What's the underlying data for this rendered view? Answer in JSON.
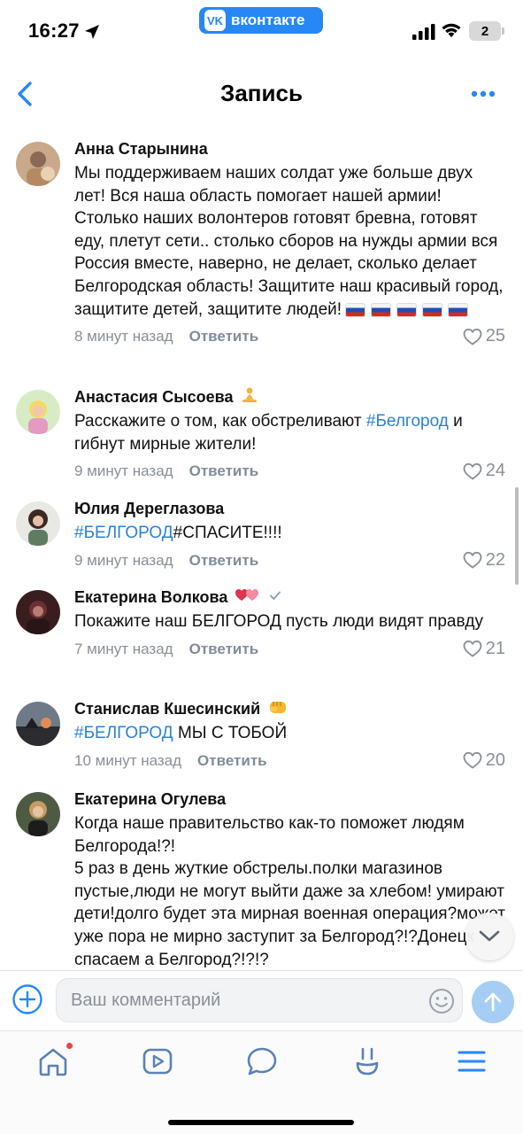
{
  "status_bar": {
    "time": "16:27",
    "app_badge": "вконтакте",
    "app_logo": "VK",
    "battery": "2"
  },
  "header": {
    "title": "Запись"
  },
  "comments": [
    {
      "author": "Анна Старынина",
      "text": "Мы поддерживаем наших солдат уже больше двух лет! Вся наша область помогает нашей армии! Столько наших волонтеров готовят бревна, готовят еду, плетут сети.. столько сборов на нужды армии вся Россия вместе, наверно, не делает, сколько делает Белгородская область! Защитите наш красивый город, защитите детей, защитите людей!",
      "time": "8 минут назад",
      "reply": "Ответить",
      "likes": "25"
    },
    {
      "author": "Анастасия Сысоева",
      "text_before": "Расскажите о том, как обстреливают ",
      "hashtag": "#Белгород",
      "text_after": " и гибнут мирные жители!",
      "time": "9 минут назад",
      "reply": "Ответить",
      "likes": "24"
    },
    {
      "author": "Юлия Дереглазова",
      "hashtag": "#БЕЛГОРОД",
      "text_after": "#СПАСИТЕ!!!!",
      "time": "9 минут назад",
      "reply": "Ответить",
      "likes": "22"
    },
    {
      "author": "Екатерина Волкова",
      "text": "Покажите наш БЕЛГОРОД пусть люди видят правду",
      "time": "7 минут назад",
      "reply": "Ответить",
      "likes": "21"
    },
    {
      "author": "Станислав Кшесинский",
      "hashtag": "#БЕЛГОРОД",
      "text_after": " МЫ С ТОБОЙ",
      "time": "10 минут назад",
      "reply": "Ответить",
      "likes": "20"
    },
    {
      "author": "Екатерина Огулева",
      "text": "Когда наше правительство как-то поможет людям Белгорода!?!\n5 раз в день жуткие обстрелы.полки магазинов пустые,люди не могут выйти даже за хлебом! умирают дети!долго будет эта мирная военная операция?может уже пора не мирно заступит за Белгород?!?Донецк спасаем а Белгород?!?!?"
    }
  ],
  "composer": {
    "placeholder": "Ваш комментарий"
  },
  "colors": {
    "accent": "#2787f5",
    "hashtag": "#2a81d8",
    "meta": "#8a8f96"
  }
}
